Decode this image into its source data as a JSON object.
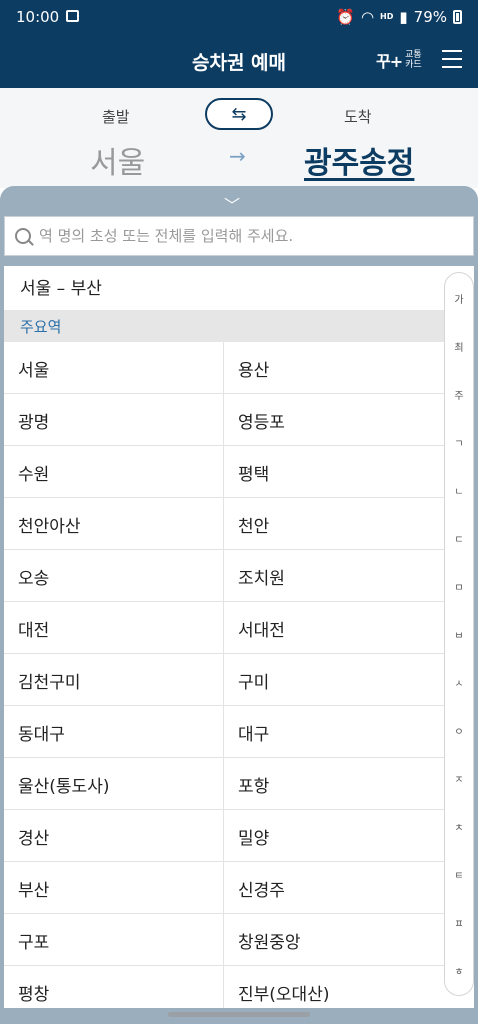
{
  "status": {
    "time": "10:00",
    "battery": "79%",
    "hd": "HD"
  },
  "header": {
    "title": "승차권 예매",
    "logo_mark": "꾸+",
    "logo_text_1": "교통",
    "logo_text_2": "카드"
  },
  "route": {
    "departure_label": "출발",
    "arrival_label": "도착",
    "departure": "서울",
    "arrow": "→",
    "arrival": "광주송정"
  },
  "search": {
    "placeholder": "역 명의 초성 또는 전체를 입력해 주세요."
  },
  "list": {
    "route_item": "서울 – 부산",
    "section_title": "주요역",
    "stations": [
      [
        "서울",
        "용산"
      ],
      [
        "광명",
        "영등포"
      ],
      [
        "수원",
        "평택"
      ],
      [
        "천안아산",
        "천안"
      ],
      [
        "오송",
        "조치원"
      ],
      [
        "대전",
        "서대전"
      ],
      [
        "김천구미",
        "구미"
      ],
      [
        "동대구",
        "대구"
      ],
      [
        "울산(통도사)",
        "포항"
      ],
      [
        "경산",
        "밀양"
      ],
      [
        "부산",
        "신경주"
      ],
      [
        "구포",
        "창원중앙"
      ],
      [
        "평창",
        "진부(오대산)"
      ]
    ]
  },
  "index": [
    "가",
    "최",
    "주",
    "ㄱ",
    "ㄴ",
    "ㄷ",
    "ㅁ",
    "ㅂ",
    "ㅅ",
    "ㅇ",
    "ㅈ",
    "ㅊ",
    "ㅌ",
    "ㅍ",
    "ㅎ"
  ],
  "colors": {
    "primary": "#0d3c63",
    "accent": "#2a6fa8",
    "sheet": "#9aaebd"
  }
}
